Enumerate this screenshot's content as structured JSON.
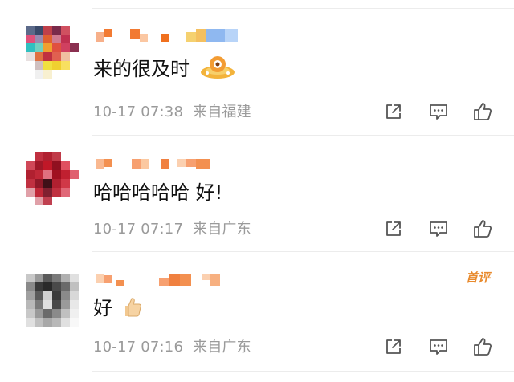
{
  "comments": [
    {
      "text": "来的很及时",
      "emoji": "ufo-emoji",
      "time": "10-17 07:38",
      "source": "来自福建",
      "badge": ""
    },
    {
      "text": "哈哈哈哈哈 好!",
      "emoji": "",
      "time": "10-17 07:17",
      "source": "来自广东",
      "badge": ""
    },
    {
      "text": "好",
      "emoji": "thumbs-up-emoji",
      "time": "10-17 07:16",
      "source": "来自广东",
      "badge": "首评"
    }
  ],
  "icons": {
    "share": "share-icon",
    "comment": "comment-icon",
    "like": "like-icon"
  },
  "colors": {
    "meta_text": "#9a9a9a",
    "badge": "#e88a2d",
    "icon": "#555555",
    "divider": "#ececec"
  }
}
